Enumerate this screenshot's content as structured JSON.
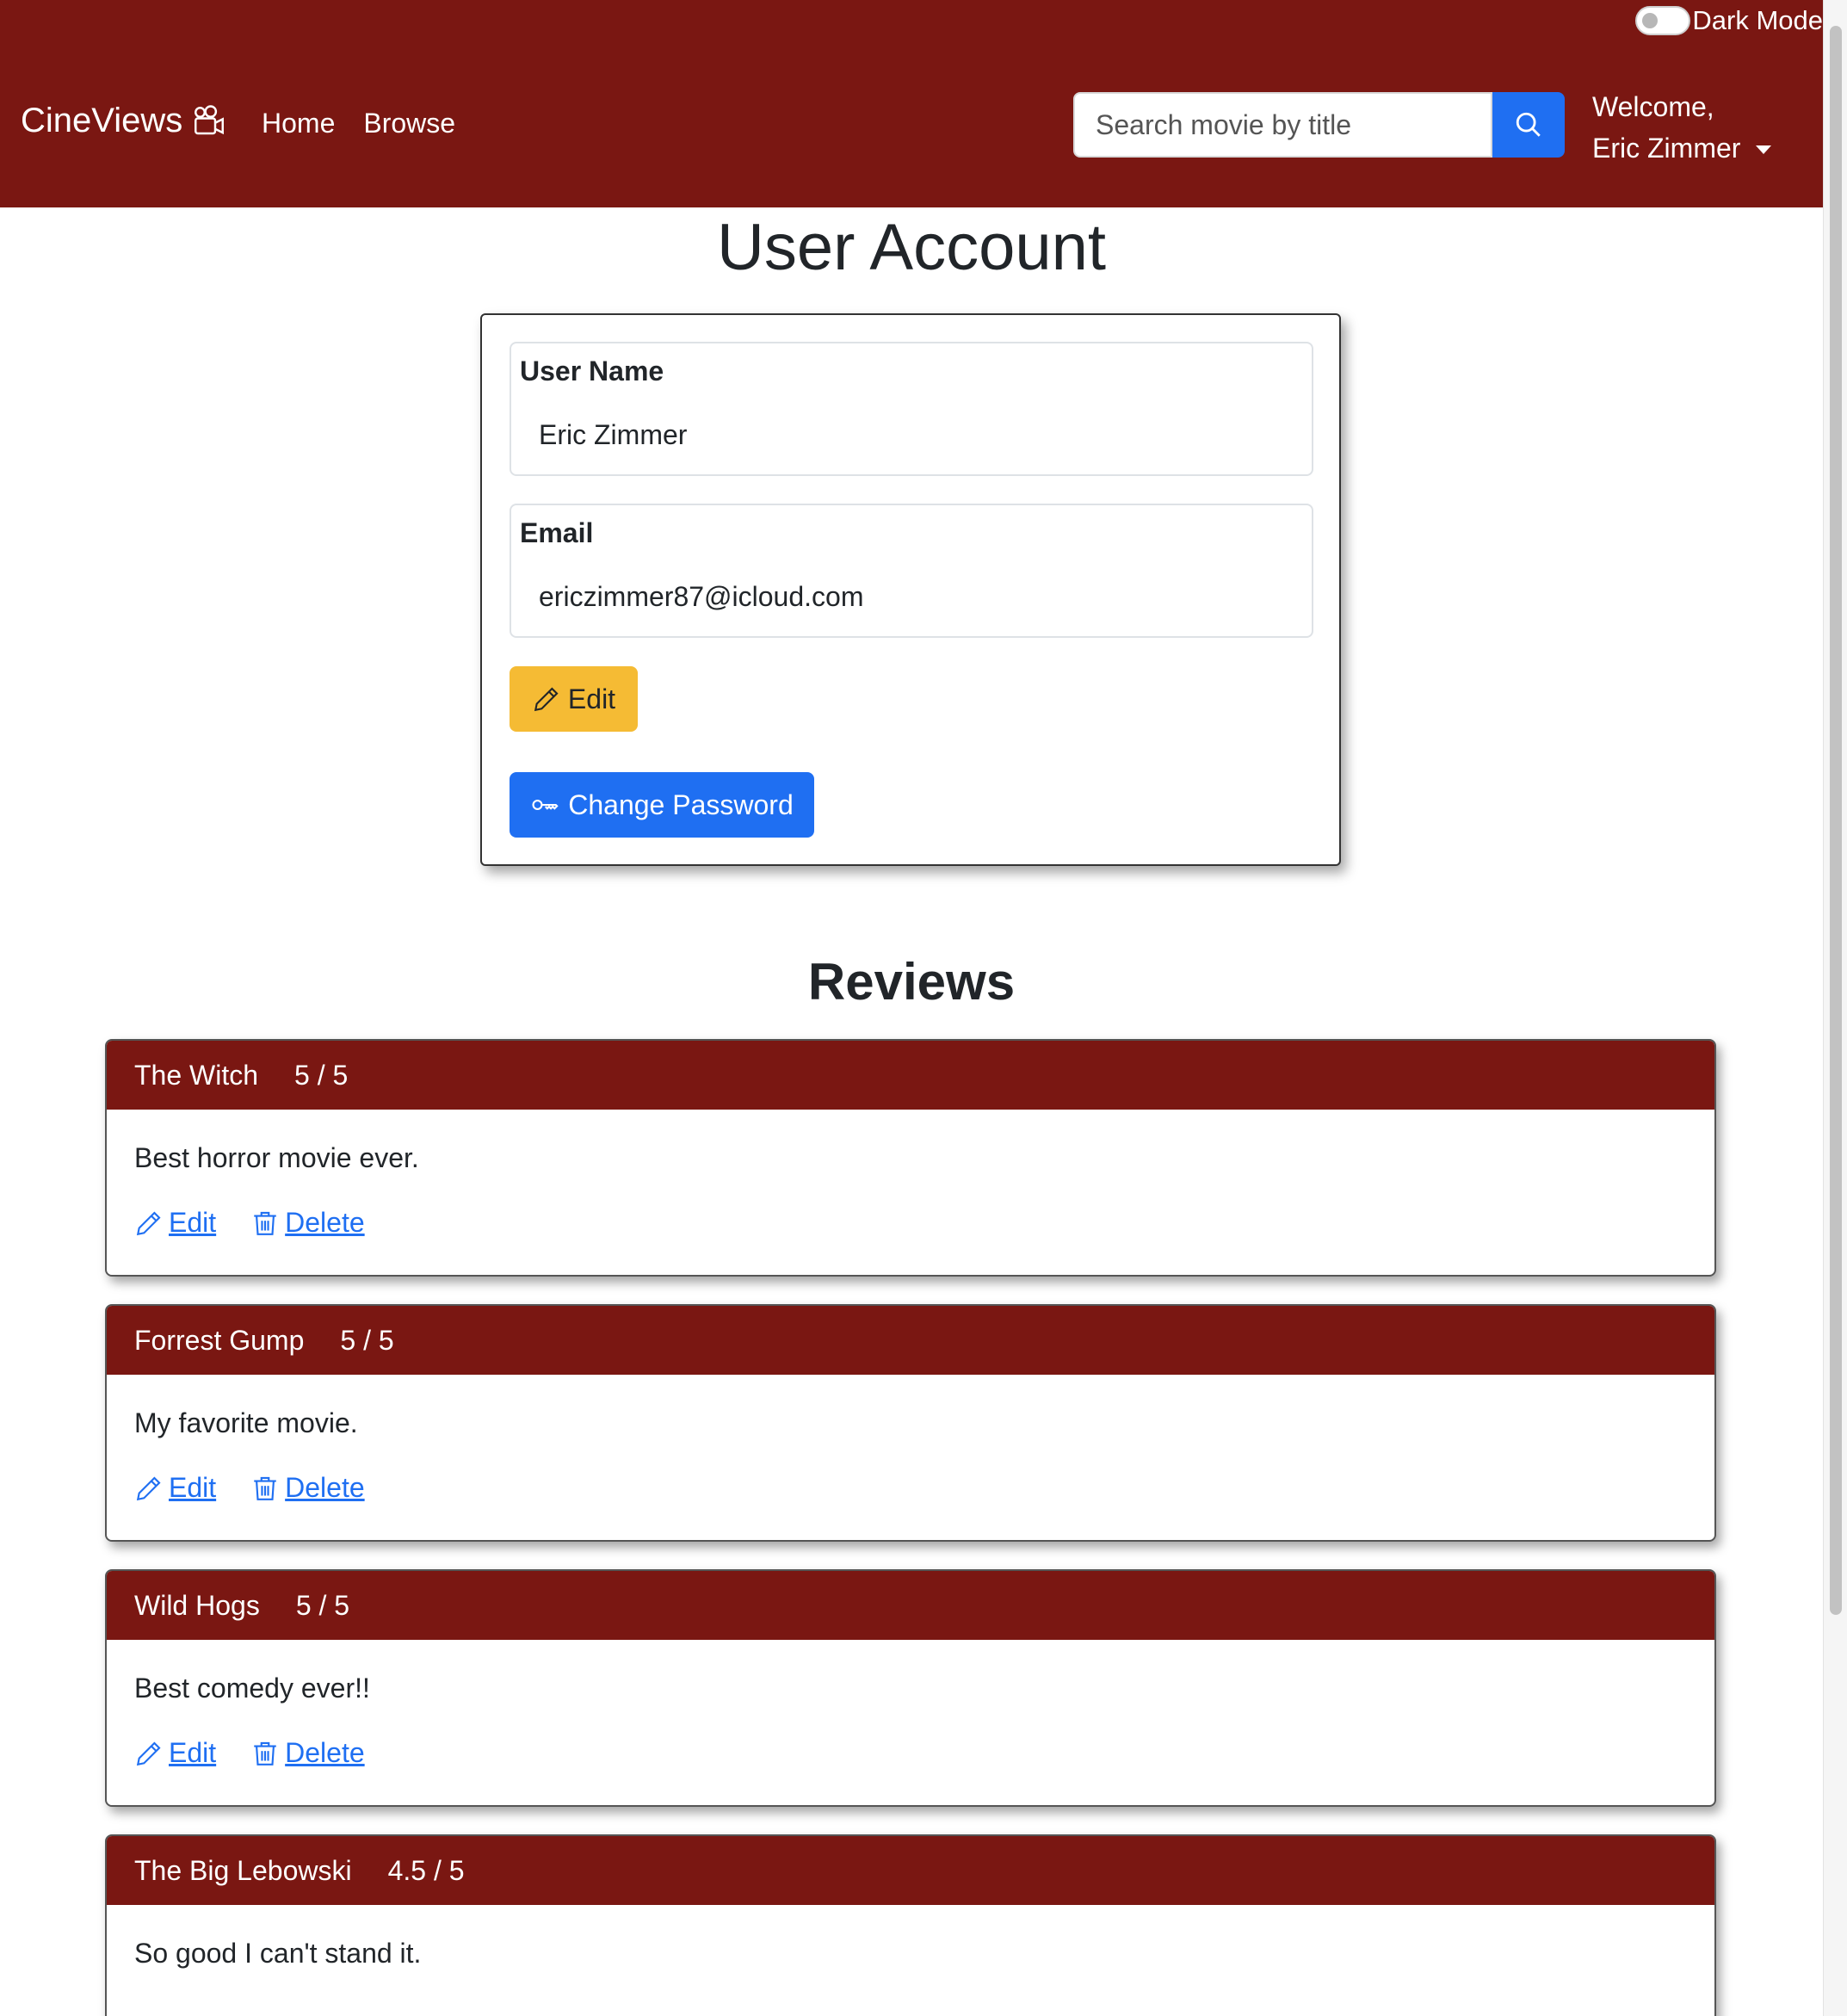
{
  "navbar": {
    "dark_mode_label": "Dark Mode",
    "brand": "CineViews",
    "links": [
      {
        "label": "Home"
      },
      {
        "label": "Browse"
      }
    ],
    "search_placeholder": "Search movie by title",
    "welcome": "Welcome,",
    "user_name": "Eric Zimmer",
    "color": "#7a1712"
  },
  "page": {
    "title": "User Account"
  },
  "account": {
    "username_label": "User Name",
    "username_value": "Eric Zimmer",
    "email_label": "Email",
    "email_value": "ericzimmer87@icloud.com",
    "edit_label": "Edit",
    "change_password_label": "Change Password"
  },
  "reviews": {
    "title": "Reviews",
    "edit_label": "Edit",
    "delete_label": "Delete",
    "items": [
      {
        "movie": "The Witch",
        "rating": "5 / 5",
        "text": "Best horror movie ever."
      },
      {
        "movie": "Forrest Gump",
        "rating": "5 / 5",
        "text": "My favorite movie."
      },
      {
        "movie": "Wild Hogs",
        "rating": "5 / 5",
        "text": "Best comedy ever!!"
      },
      {
        "movie": "The Big Lebowski",
        "rating": "4.5 / 5",
        "text": "So good I can't stand it."
      }
    ]
  },
  "colors": {
    "primary": "#1f6ff2",
    "warning": "#f5bb34",
    "brand": "#7a1712"
  }
}
